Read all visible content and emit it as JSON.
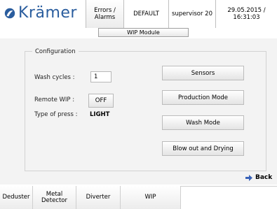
{
  "header": {
    "brand": "Krämer",
    "errors_line1": "Errors /",
    "errors_line2": "Alarms",
    "mode": "DEFAULT",
    "user": "supervisor 20",
    "datetime": "29.05.2015 / 16:31:03"
  },
  "module_title": "WIP Module",
  "configuration": {
    "legend": "Configuration",
    "wash_cycles_label": "Wash cycles :",
    "wash_cycles_value": "1",
    "remote_wip_label": "Remote WIP :",
    "remote_wip_value": "OFF",
    "press_type_label": "Type of press :",
    "press_type_value": "LIGHT"
  },
  "actions": {
    "sensors": "Sensors",
    "production_mode": "Production Mode",
    "wash_mode": "Wash Mode",
    "blow_out": "Blow out and Drying"
  },
  "back_label": "Back",
  "tabs": {
    "deduster": "Deduster",
    "metal_line1": "Metal",
    "metal_line2": "Detector",
    "diverter": "Diverter",
    "wip": "WIP"
  },
  "colors": {
    "brand": "#2a5d9e",
    "back_arrow": "#3a63b8"
  },
  "icons": {
    "logo": "kramer-logo-icon",
    "back": "arrow-right-icon"
  }
}
